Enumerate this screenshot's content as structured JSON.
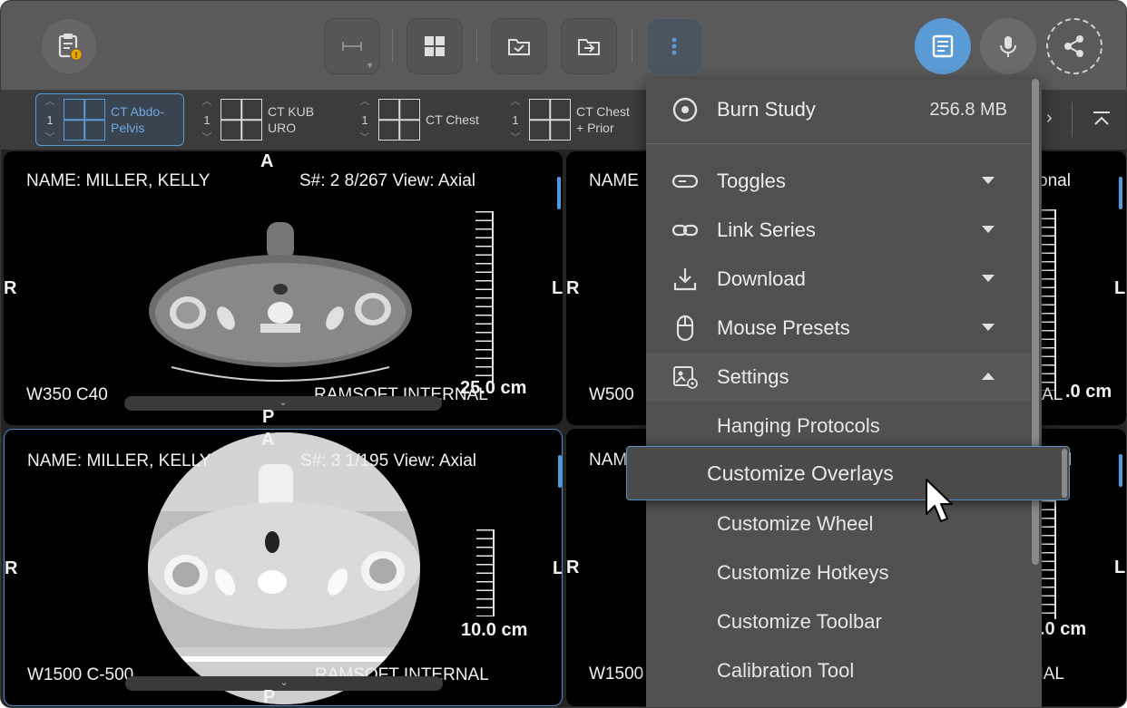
{
  "toolbar": {
    "accent": "#5b9bd5",
    "icons": [
      "clipboard-alert-icon",
      "measure-icon",
      "layout-grid-icon",
      "folder-check-icon",
      "folder-arrow-icon",
      "more-vertical-icon",
      "report-icon",
      "microphone-icon",
      "share-icon"
    ]
  },
  "layouts": [
    {
      "count": "1",
      "label": "CT Abdo-Pelvis",
      "line1": "CT Abdo-",
      "line2": "Pelvis",
      "selected": true
    },
    {
      "count": "1",
      "label": "CT KUB URO",
      "line1": "CT KUB",
      "line2": "URO"
    },
    {
      "count": "1",
      "label": "CT Chest",
      "line1": "CT Chest",
      "line2": ""
    },
    {
      "count": "1",
      "label": "CT Chest + Prior",
      "line1": "CT Chest",
      "line2": "+ Prior"
    }
  ],
  "viewports": [
    {
      "name": "NAME: MILLER, KELLY",
      "series": "S#: 2  8/267  View: Axial",
      "window": "W350 C40",
      "institution": "RAMSOFT INTERNAL",
      "scale": "25.0 cm",
      "top": "A",
      "bottom": "P",
      "left": "R",
      "right": "L"
    },
    {
      "name": "NAME: MILLER, KELLY",
      "series": "S#: 3  1/195  View: Axial",
      "window": "W1500 C-500",
      "institution": "RAMSOFT INTERNAL",
      "scale": "10.0 cm",
      "top": "A",
      "bottom": "P",
      "left": "R",
      "right": "L"
    },
    {
      "name": "NAME",
      "series_tail": "onal",
      "window": "W500",
      "inst_tail": "AL",
      "scale_tail": ".0 cm",
      "left": "R",
      "right": "L"
    },
    {
      "name": "NAM",
      "series_tail": "l",
      "window": "W1500",
      "inst_tail": "NAL",
      "scale_tail": ".0 cm",
      "left": "R",
      "right": "L"
    }
  ],
  "menu": {
    "burn": {
      "label": "Burn Study",
      "size": "256.8 MB"
    },
    "items": [
      {
        "label": "Toggles",
        "expanded": false
      },
      {
        "label": "Link Series",
        "expanded": false
      },
      {
        "label": "Download",
        "expanded": false
      },
      {
        "label": "Mouse Presets",
        "expanded": false
      },
      {
        "label": "Settings",
        "expanded": true
      }
    ],
    "settings_sub": [
      "Hanging Protocols",
      "Customize Overlays",
      "Customize Wheel",
      "Customize Hotkeys",
      "Customize Toolbar",
      "Calibration Tool"
    ],
    "highlighted": "Customize Overlays"
  }
}
